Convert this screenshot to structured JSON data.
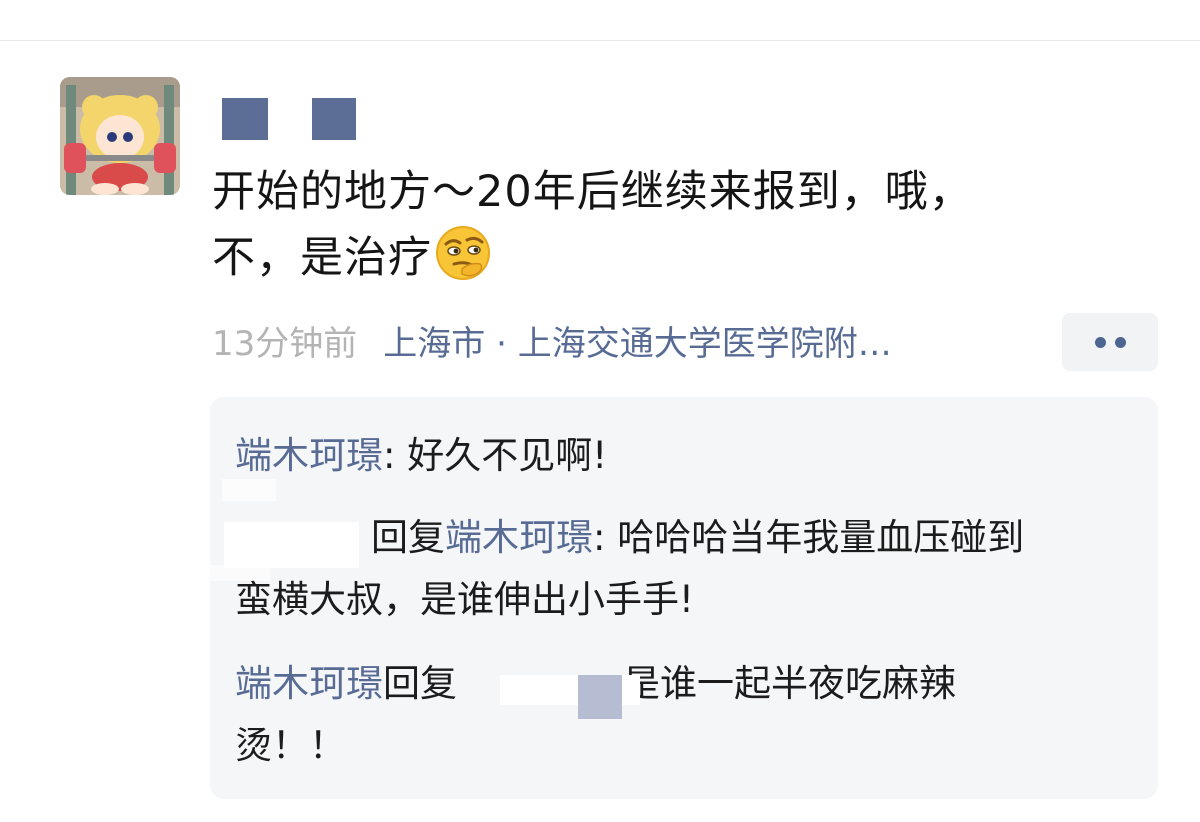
{
  "post": {
    "avatar_icon": "cartoon-girl-lifting-barbell",
    "text_line1": "开始的地方～20年后继续来报到，哦，",
    "text_line2": "不，是治疗",
    "emoji_icon": "thinking-face-emoji",
    "time": "13分钟前",
    "location": "上海市 · 上海交通大学医学院附…",
    "more_icon": "more-dots-icon"
  },
  "comments": [
    {
      "author": "端木珂璟",
      "text": ": 好久不见啊!"
    },
    {
      "reply_word": "回复",
      "to": "端木珂璟",
      "text_line1": ": 哈哈哈当年我量血压碰到",
      "text_line2": "蛮横大叔，是谁伸出小手手!"
    },
    {
      "author": "端木珂璟",
      "reply_word": "回复",
      "text_line1": "是谁一起半夜吃麻辣",
      "text_line2": "烫！！"
    }
  ],
  "colors": {
    "link": "#576b95",
    "time": "#b4b4b4",
    "comment_bg": "#f5f6f7"
  }
}
